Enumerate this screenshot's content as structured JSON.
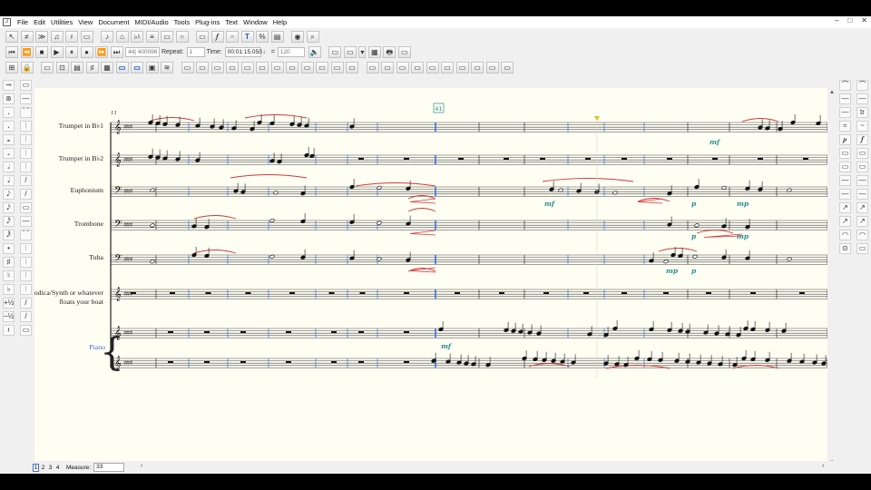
{
  "menubar": {
    "app_icon": "sheet-music-app-icon",
    "items": [
      "File",
      "Edit",
      "Utilities",
      "View",
      "Document",
      "MIDI/Audio",
      "Tools",
      "Plug-ins",
      "Text",
      "Window",
      "Help"
    ],
    "window_controls": [
      "–",
      "□",
      "✕"
    ]
  },
  "toolbar1": {
    "glyphs": [
      "↖",
      "≠",
      "≫",
      "♫",
      "𝄽",
      "▭",
      "♪",
      "⌂",
      "♭♮",
      "≡",
      "▭",
      "○",
      "▭",
      "𝆑",
      "𝄐",
      "T",
      "%",
      "▤"
    ],
    "round": [
      "◉",
      "⌕"
    ]
  },
  "toolbar2": {
    "transport": [
      "⏮",
      "⏪",
      "■",
      "▶",
      "⏸",
      "●",
      "⏩",
      "⏭"
    ],
    "measure_field": "44| 400096",
    "repeat_label": "Repeat:",
    "repeat_value": "1",
    "time_label": "Time:",
    "time_value": "00:01:15.050",
    "tempo_note": "♩ =",
    "tempo_value": "120",
    "speaker": "🔈",
    "right_glyphs": [
      "▭",
      "▭",
      "▾",
      "▦",
      "🖶",
      "▭"
    ]
  },
  "toolbar3": {
    "glyphs": [
      "⊞",
      "🔒",
      "▭",
      "⊡",
      "▤",
      "♯",
      "▦",
      "▭",
      "▭",
      "▣",
      "≋",
      "▭",
      "▭",
      "▭",
      "▭",
      "▭",
      "▭",
      "▭",
      "▭",
      "▭",
      "▭",
      "▭",
      "▭",
      "▭",
      "▭",
      "▭",
      "▭",
      "▭",
      "▭",
      "▭",
      "▭",
      "▭",
      "▭"
    ]
  },
  "left_palette": {
    "glyphs": [
      "⊸",
      "⊛",
      "𝆺",
      "𝆺",
      "𝅝",
      "𝅗",
      "𝅗𝅥",
      "𝅘𝅥",
      "𝅘𝅥𝅮",
      "𝅘𝅥𝅯",
      "𝅘𝅥𝅰",
      "𝅘𝅥𝅱",
      "•",
      "♯",
      "♮",
      "♭",
      "+½",
      "−½",
      "𝄽",
      "𝄾",
      "♩",
      "♪"
    ],
    "second_column": [
      "▭",
      "—",
      "⁀",
      "𝄀",
      "𝄀",
      "𝄀",
      "𝄀",
      "/",
      "/"
    ]
  },
  "right_palette": {
    "glyphs": [
      "⌒",
      "⌒",
      "—",
      "—",
      "—",
      "tr",
      "≈",
      "~",
      "𝆏",
      "𝆑",
      "▭",
      "▭",
      "▭",
      "▭",
      "—",
      "—",
      "—",
      "—",
      "↗",
      "↗",
      "↗",
      "↗",
      "◠",
      "◠",
      "⊙",
      "▭"
    ]
  },
  "score": {
    "rehearsal_mark": "41",
    "measure_number": "11",
    "staves": [
      {
        "name": "Trumpet in B♭1"
      },
      {
        "name": "Trumpet in B♭2"
      },
      {
        "name": "Euphonium"
      },
      {
        "name": "Trombone"
      },
      {
        "name": "Tuba"
      },
      {
        "name": "Melodica/Synth or whatever floats your boat"
      },
      {
        "name": "Piano"
      }
    ],
    "dynamics": [
      {
        "text": "mf"
      },
      {
        "text": "mf"
      },
      {
        "text": "p"
      },
      {
        "text": "mp"
      },
      {
        "text": "p"
      },
      {
        "text": "mp"
      },
      {
        "text": "mp"
      },
      {
        "text": "p"
      },
      {
        "text": "mf"
      }
    ]
  },
  "statusbar": {
    "pages": [
      "1",
      "2",
      "3",
      "4"
    ],
    "measure_label": "Measure:",
    "measure_value": "33"
  },
  "colors": {
    "score_background": "#fefef3",
    "selection_blue": "#3a6fd8",
    "slur_red": "#d23838",
    "dynamic_teal": "#2a8f8a"
  }
}
